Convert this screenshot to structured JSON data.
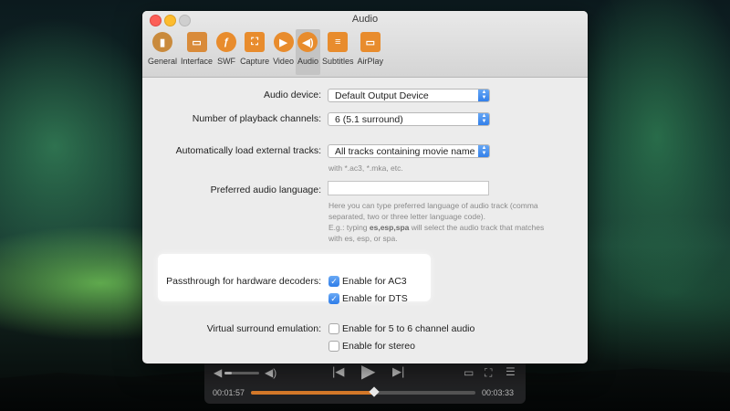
{
  "window": {
    "title": "Audio"
  },
  "tabs": [
    {
      "label": "General",
      "icon": "general-icon",
      "color": "#c98a3c"
    },
    {
      "label": "Interface",
      "icon": "interface-icon",
      "color": "#d98b3a"
    },
    {
      "label": "SWF",
      "icon": "swf-icon",
      "color": "#e88c2d"
    },
    {
      "label": "Capture",
      "icon": "capture-icon",
      "color": "#e88c2d"
    },
    {
      "label": "Video",
      "icon": "video-icon",
      "color": "#e88c2d"
    },
    {
      "label": "Audio",
      "icon": "audio-icon",
      "color": "#e88c2d",
      "active": true
    },
    {
      "label": "Subtitles",
      "icon": "subtitles-icon",
      "color": "#e88c2d"
    },
    {
      "label": "AirPlay",
      "icon": "airplay-icon",
      "color": "#e88c2d"
    }
  ],
  "audio": {
    "device_label": "Audio device:",
    "device_value": "Default Output Device",
    "channels_label": "Number of playback channels:",
    "channels_value": "6 (5.1 surround)",
    "external_label": "Automatically load external tracks:",
    "external_value": "All tracks containing movie name",
    "external_hint": "with *.ac3, *.mka, etc.",
    "language_label": "Preferred audio language:",
    "language_value": "",
    "language_hint_1": "Here you can type preferred language of audio track (comma",
    "language_hint_2": "separated, two or three letter language code).",
    "language_hint_3": "E.g.: typing ",
    "language_hint_codes": "es,esp,spa",
    "language_hint_4": " will select the audio track that matches",
    "language_hint_5": "with es, esp, or spa.",
    "passthrough_label": "Passthrough for hardware decoders:",
    "ac3_label": "Enable for AC3",
    "ac3_checked": true,
    "dts_label": "Enable for DTS",
    "dts_checked": true,
    "virtual_label": "Virtual surround emulation:",
    "five_six_label": "Enable for 5 to 6 channel audio",
    "five_six_checked": false,
    "stereo_label": "Enable for stereo",
    "stereo_checked": false
  },
  "player": {
    "elapsed": "00:01:57",
    "total": "00:03:33",
    "progress": 0.55,
    "volume": 0.2
  },
  "colors": {
    "accent": "#2e7ce9",
    "progress": "#d77a2a",
    "highlight": "#ffffff"
  }
}
